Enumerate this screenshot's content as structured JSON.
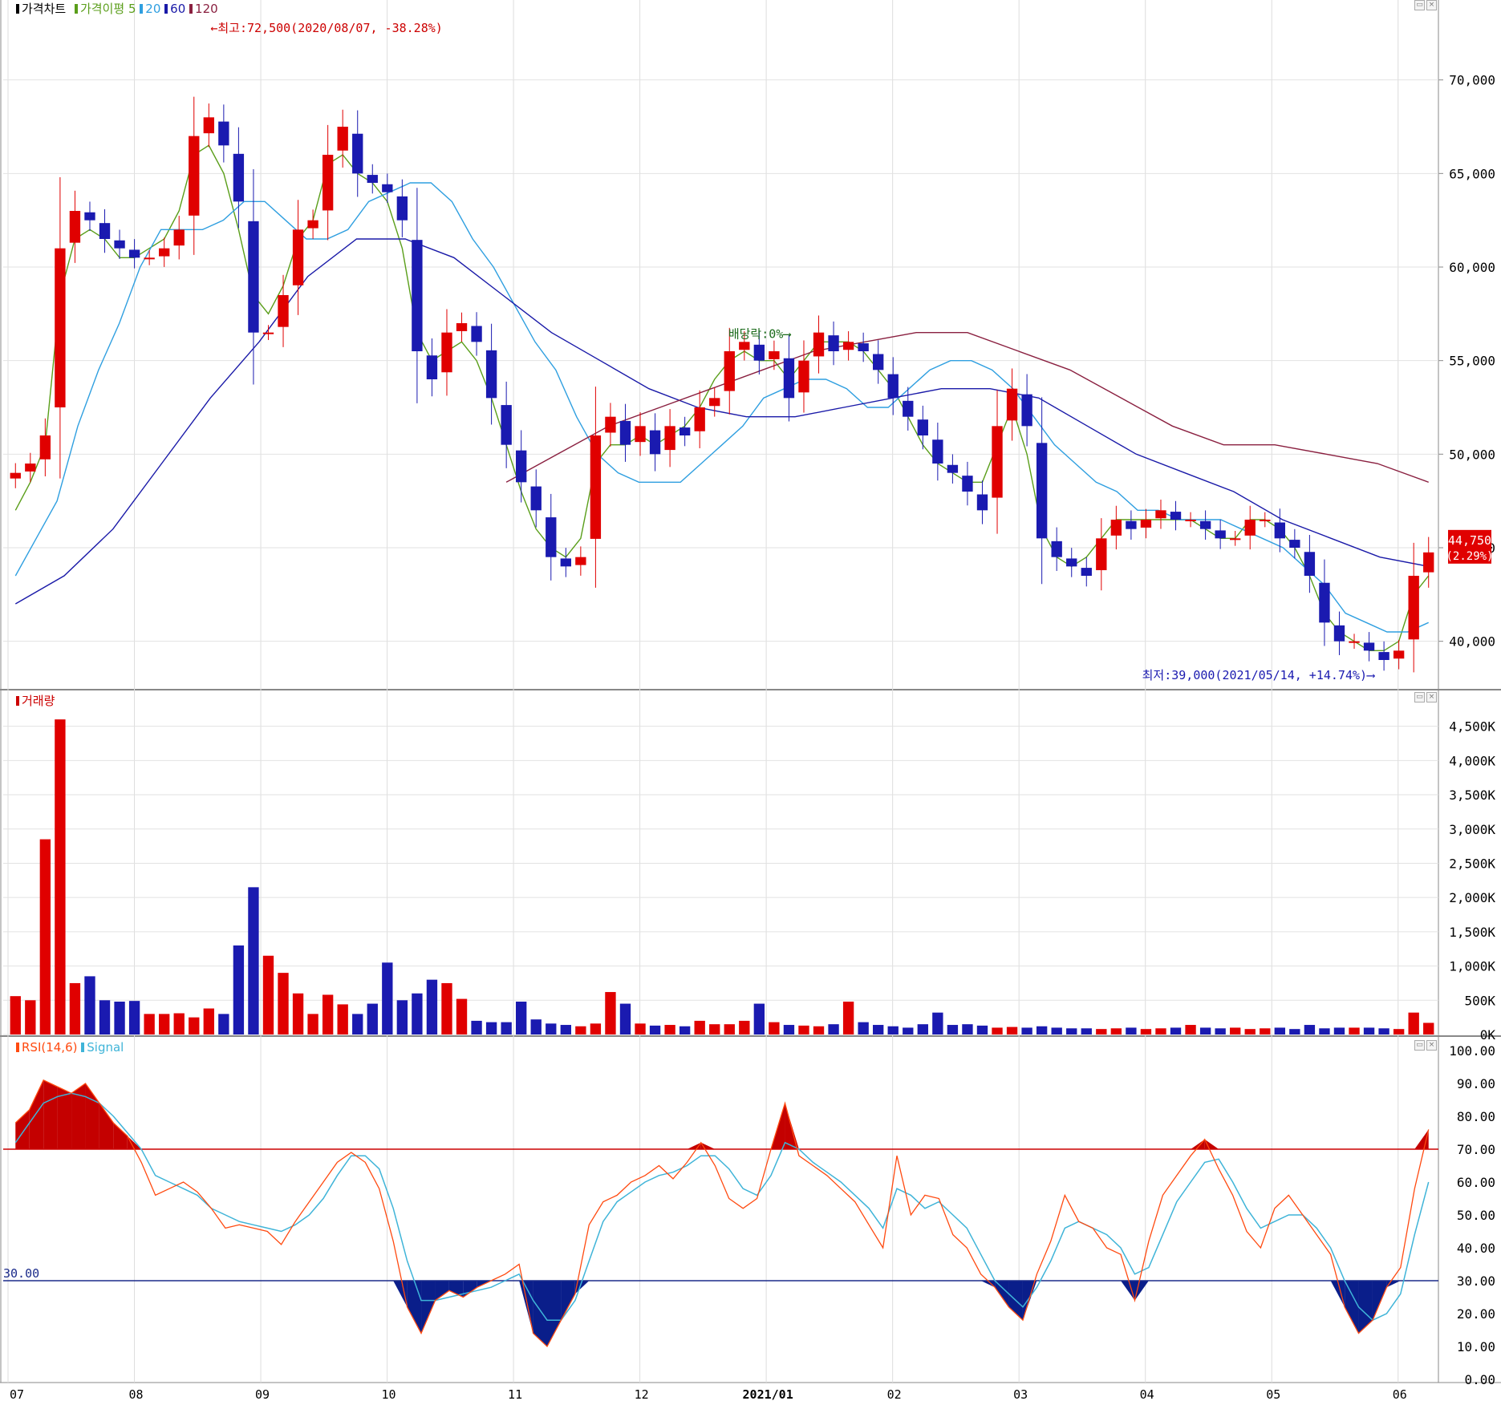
{
  "price_panel": {
    "title": "가격차트",
    "legend_ma_label": "가격이평",
    "ma_periods": [
      "5",
      "20",
      "60",
      "120"
    ],
    "ma_colors": [
      "#5a9e1a",
      "#2f9fe0",
      "#1a1aa8",
      "#8a2040"
    ],
    "annotation_high": "←최고:72,500(2020/08/07, -38.28%)",
    "annotation_low": "최저:39,000(2021/05/14, +14.74%)⟶",
    "annotation_dividend": "배당락:0%⟶",
    "last_price_box": "44,750",
    "last_change_box": "(2.29%)",
    "y_ticks": [
      "40,000",
      "45,000",
      "50,000",
      "55,000",
      "60,000",
      "65,000",
      "70,000"
    ]
  },
  "volume_panel": {
    "title": "거래량",
    "y_ticks": [
      "0K",
      "500K",
      "1,000K",
      "1,500K",
      "2,000K",
      "2,500K",
      "3,000K",
      "3,500K",
      "4,000K",
      "4,500K"
    ]
  },
  "rsi_panel": {
    "title_rsi": "RSI(14,6)",
    "title_signal": "Signal",
    "oversold_label": "30.00",
    "y_ticks": [
      "0.00",
      "10.00",
      "20.00",
      "30.00",
      "40.00",
      "50.00",
      "60.00",
      "70.00",
      "80.00",
      "90.00",
      "100.00"
    ]
  },
  "x_axis_labels": [
    "07",
    "08",
    "09",
    "10",
    "11",
    "12",
    "2021/01",
    "02",
    "03",
    "04",
    "05",
    "06"
  ],
  "colors": {
    "up": "#e00000",
    "down": "#1a1ab0",
    "rsi": "#ff4a10",
    "signal": "#3fb4d8",
    "overbought_line": "#cc0000",
    "oversold_line": "#1a2a8a"
  },
  "chart_data": [
    {
      "type": "candlestick",
      "title": "가격차트",
      "x_range": [
        "2020-07",
        "2021-06"
      ],
      "ylim": [
        37500,
        73500
      ],
      "high": {
        "value": 72500,
        "date": "2020/08/07"
      },
      "low": {
        "value": 39000,
        "date": "2021/05/14"
      },
      "last_close": 44750,
      "last_change_pct": 2.29,
      "series": [
        {
          "name": "종가",
          "values": [
            49000,
            49500,
            51000,
            61000,
            63000,
            62500,
            61500,
            61000,
            60500,
            60500,
            61000,
            62000,
            67000,
            68000,
            66500,
            63500,
            56500,
            56500,
            58500,
            62000,
            62500,
            66000,
            67500,
            65000,
            64500,
            64000,
            62500,
            55500,
            54000,
            56500,
            57000,
            56000,
            53000,
            50500,
            48500,
            47000,
            44500,
            44000,
            44500,
            51000,
            52000,
            50500,
            51500,
            50000,
            51500,
            51000,
            52500,
            53000,
            55500,
            56000,
            55000,
            55500,
            53000,
            55000,
            56500,
            55500,
            56000,
            55500,
            54500,
            53000,
            52000,
            51000,
            49500,
            49000,
            48000,
            47000,
            51500,
            53500,
            51500,
            45500,
            44500,
            44000,
            43500,
            45500,
            46500,
            46000,
            46500,
            47000,
            46500,
            46500,
            46000,
            45500,
            45500,
            46500,
            46500,
            45500,
            45000,
            43500,
            41000,
            40000,
            40000,
            39500,
            39000,
            39500,
            43500,
            44750
          ]
        },
        {
          "name": "5",
          "values": [
            47000,
            48500,
            50500,
            58500,
            61500,
            62000,
            61500,
            60500,
            60500,
            61000,
            61500,
            63000,
            66000,
            66500,
            65000,
            62000,
            58500,
            57500,
            59000,
            61500,
            62500,
            65500,
            66000,
            65000,
            64500,
            63500,
            61000,
            56500,
            55000,
            55500,
            56000,
            55000,
            53000,
            50500,
            48000,
            46000,
            45000,
            44500,
            45500,
            49500,
            50500,
            50500,
            51000,
            50500,
            51000,
            51500,
            52500,
            54000,
            55000,
            55500,
            55000,
            55000,
            54000,
            55000,
            56000,
            56000,
            56000,
            55500,
            54500,
            53500,
            52000,
            50500,
            49500,
            49000,
            48500,
            48500,
            50500,
            52500,
            50000,
            46000,
            44500,
            44000,
            44500,
            45500,
            46500,
            46500,
            46500,
            46500,
            46500,
            46500,
            46000,
            45500,
            45500,
            46500,
            46500,
            46000,
            45000,
            43500,
            41500,
            40500,
            40000,
            39500,
            39500,
            40000,
            42500,
            43500
          ]
        },
        {
          "name": "20",
          "values": [
            43500,
            45500,
            47500,
            51500,
            54500,
            57000,
            60000,
            62000,
            62000,
            62000,
            62500,
            63500,
            63500,
            62500,
            61500,
            61500,
            62000,
            63500,
            64000,
            64500,
            64500,
            63500,
            61500,
            60000,
            58000,
            56000,
            54500,
            52000,
            50000,
            49000,
            48500,
            48500,
            48500,
            49500,
            50500,
            51500,
            53000,
            53500,
            54000,
            54000,
            53500,
            52500,
            52500,
            53500,
            54500,
            55000,
            55000,
            54500,
            53500,
            52000,
            50500,
            49500,
            48500,
            48000,
            47000,
            47000,
            46500,
            46500,
            46500,
            46000,
            45500,
            45000,
            44000,
            43000,
            41500,
            41000,
            40500,
            40500,
            41000
          ]
        },
        {
          "name": "60",
          "values": [
            42000,
            43500,
            46000,
            49500,
            53000,
            56000,
            59500,
            61500,
            61500,
            60500,
            58500,
            56500,
            55000,
            53500,
            52500,
            52000,
            52000,
            52500,
            53000,
            53500,
            53500,
            53000,
            51500,
            50000,
            49000,
            48000,
            46500,
            45500,
            44500,
            44000
          ]
        },
        {
          "name": "120",
          "values": [
            48500,
            50000,
            51500,
            52500,
            53500,
            54500,
            55500,
            56000,
            56500,
            56500,
            55500,
            54500,
            53000,
            51500,
            50500,
            50500,
            50000,
            49500,
            48500
          ]
        }
      ]
    },
    {
      "type": "bar",
      "title": "거래량",
      "ylim": [
        0,
        4800000
      ],
      "series": [
        {
          "name": "거래량",
          "values": [
            560000,
            500000,
            2850000,
            4600000,
            750000,
            850000,
            500000,
            480000,
            490000,
            300000,
            300000,
            310000,
            250000,
            380000,
            300000,
            1300000,
            2150000,
            1150000,
            900000,
            600000,
            300000,
            580000,
            440000,
            300000,
            450000,
            1050000,
            500000,
            600000,
            800000,
            750000,
            520000,
            200000,
            180000,
            180000,
            480000,
            220000,
            160000,
            140000,
            120000,
            160000,
            620000,
            450000,
            160000,
            130000,
            140000,
            120000,
            200000,
            150000,
            150000,
            200000,
            450000,
            180000,
            140000,
            130000,
            120000,
            150000,
            480000,
            180000,
            140000,
            120000,
            100000,
            150000,
            320000,
            140000,
            150000,
            130000,
            100000,
            110000,
            100000,
            120000,
            100000,
            90000,
            90000,
            80000,
            90000,
            100000,
            80000,
            90000,
            100000,
            140000,
            100000,
            90000,
            100000,
            80000,
            90000,
            100000,
            80000,
            140000,
            90000,
            100000,
            100000,
            100000,
            90000,
            80000,
            320000,
            170000
          ]
        }
      ]
    },
    {
      "type": "line",
      "title": "RSI(14,6)",
      "ylim": [
        0,
        100
      ],
      "reference_lines": [
        70,
        30
      ],
      "series": [
        {
          "name": "RSI(14,6)",
          "values": [
            78,
            82,
            91,
            89,
            87,
            90,
            84,
            78,
            74,
            66,
            56,
            58,
            60,
            57,
            52,
            46,
            47,
            46,
            45,
            41,
            48,
            54,
            60,
            66,
            69,
            66,
            58,
            42,
            22,
            14,
            24,
            27,
            25,
            28,
            30,
            32,
            35,
            14,
            10,
            18,
            26,
            47,
            54,
            56,
            60,
            62,
            65,
            61,
            66,
            72,
            65,
            55,
            52,
            55,
            70,
            84,
            68,
            65,
            62,
            58,
            54,
            47,
            40,
            68,
            50,
            56,
            55,
            44,
            40,
            32,
            28,
            22,
            18,
            32,
            42,
            56,
            48,
            46,
            40,
            38,
            24,
            42,
            56,
            62,
            68,
            73,
            64,
            56,
            45,
            40,
            52,
            56,
            50,
            44,
            38,
            22,
            14,
            18,
            28,
            34,
            58,
            76
          ]
        },
        {
          "name": "Signal",
          "values": [
            72,
            78,
            84,
            86,
            87,
            86,
            84,
            80,
            75,
            70,
            62,
            60,
            58,
            56,
            52,
            50,
            48,
            47,
            46,
            45,
            47,
            50,
            55,
            62,
            68,
            68,
            64,
            52,
            36,
            24,
            24,
            25,
            26,
            27,
            28,
            30,
            32,
            24,
            18,
            18,
            24,
            36,
            48,
            54,
            57,
            60,
            62,
            63,
            65,
            68,
            68,
            64,
            58,
            56,
            62,
            72,
            70,
            66,
            63,
            60,
            56,
            52,
            46,
            58,
            56,
            52,
            54,
            50,
            46,
            38,
            30,
            26,
            22,
            28,
            36,
            46,
            48,
            46,
            44,
            40,
            32,
            34,
            44,
            54,
            60,
            66,
            67,
            60,
            52,
            46,
            48,
            50,
            50,
            46,
            40,
            30,
            22,
            18,
            20,
            26,
            44,
            60
          ]
        }
      ]
    }
  ]
}
